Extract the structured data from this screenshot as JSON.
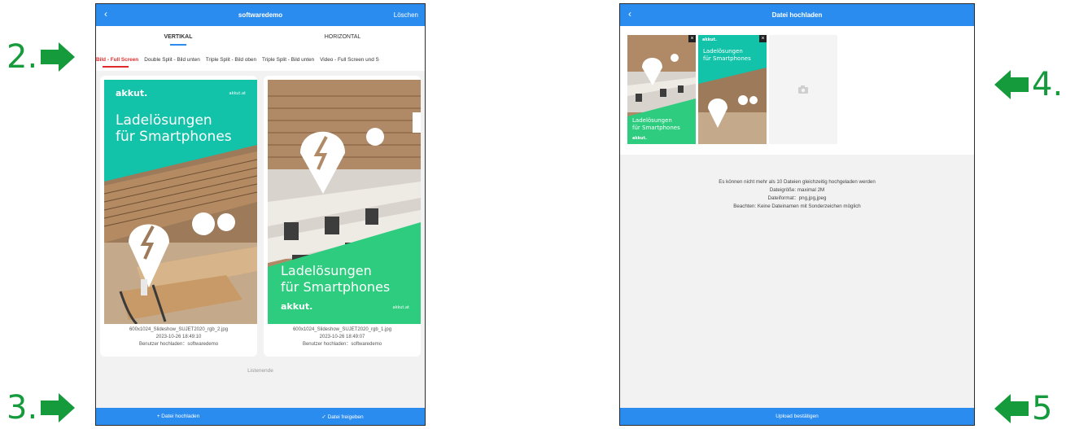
{
  "annotations": {
    "a2": "2.",
    "a3": "3.",
    "a4": "4.",
    "a5": "5"
  },
  "screen1": {
    "title": "softwaredemo",
    "back_icon": "‹",
    "delete_label": "Löschen",
    "tabs": [
      "VERTIKAL",
      "HORIZONTAL"
    ],
    "subtabs": [
      "Bild - Full Screen",
      "Double Split - Bild unten",
      "Triple Split - Bild oben",
      "Triple Split - Bild unten",
      "Video - Full Screen und S"
    ],
    "cards": [
      {
        "filename": "600x1024_Slideshow_SUJET2020_rgb_2.jpg",
        "date": "2023-10-26 18:49:10",
        "uploader": "Benutzer hochladen：softwaredemo",
        "brand": "akkut.",
        "domain": "akkut.at",
        "headline1": "Ladelösungen",
        "headline2": "für Smartphones"
      },
      {
        "filename": "600x1024_Slideshow_SUJET2020_rgb_1.jpg",
        "date": "2023-10-26 18:49:07",
        "uploader": "Benutzer hochladen：softwaredemo",
        "brand": "akkut.",
        "domain": "akkut.at",
        "headline1": "Ladelösungen",
        "headline2": "für Smartphones"
      }
    ],
    "list_end": "Listenende",
    "upload_label": "+ Datei hochladen",
    "release_label": "✓ Datei freigeben"
  },
  "screen2": {
    "title": "Datei hochladen",
    "back_icon": "‹",
    "thumb1": {
      "headline1": "Ladelösungen",
      "headline2": "für Smartphones",
      "brand": "akkut."
    },
    "thumb2": {
      "headline1": "Ladelösungen",
      "headline2": "für Smartphones",
      "brand": "akkut."
    },
    "info": [
      "Es können nicht mehr als 10 Dateien gleichzeitig hochgeladen werden",
      "Dateigröße: maximal 2M",
      "Dateiformat：png,jpg,jpeg",
      "Beachten: Keine Dateinamen mit Sonderzeichen möglich"
    ],
    "confirm_label": "Upload bestätigen"
  },
  "colors": {
    "brand_blue": "#2b8cf0",
    "annotation_green": "#159a3c",
    "teal": "#12c2a9",
    "green": "#2dcc7e",
    "active_red": "#e12b2b"
  }
}
